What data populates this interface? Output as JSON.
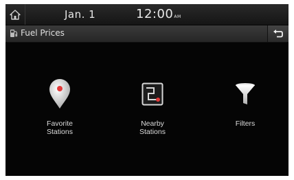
{
  "status": {
    "date": "Jan. 1",
    "time": "12:00",
    "ampm": "AM"
  },
  "header": {
    "title": "Fuel Prices"
  },
  "menu": {
    "items": [
      {
        "label": "Favorite\nStations",
        "icon": "map-pin-icon"
      },
      {
        "label": "Nearby\nStations",
        "icon": "nearby-map-icon"
      },
      {
        "label": "Filters",
        "icon": "funnel-icon"
      }
    ]
  },
  "colors": {
    "background": "#050505",
    "accent_red": "#e23a3a"
  }
}
